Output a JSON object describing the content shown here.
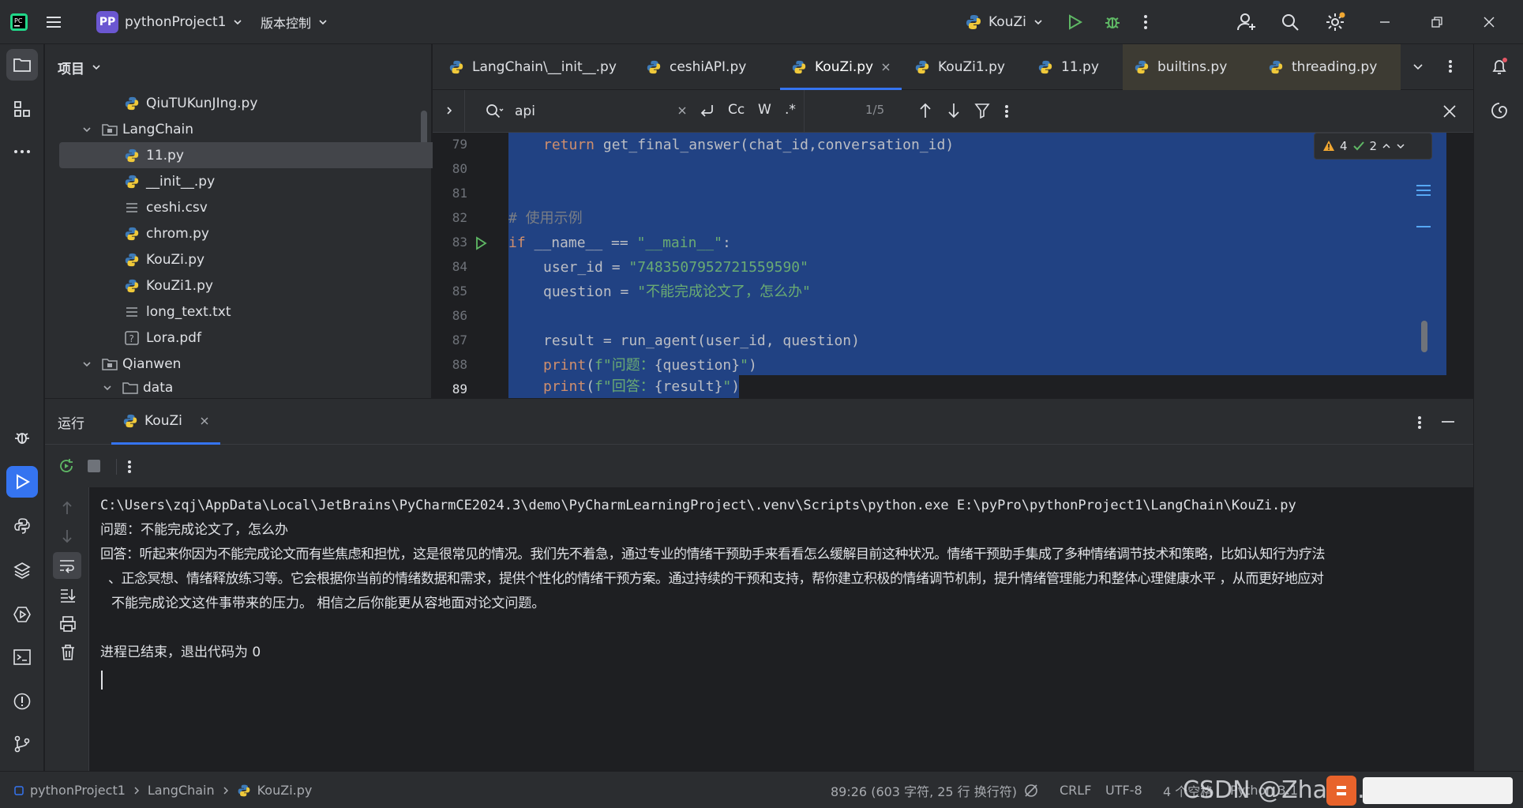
{
  "titlebar": {
    "project_initials": "PP",
    "project_name": "pythonProject1",
    "vcs_label": "版本控制",
    "run_config": "KouZi"
  },
  "project_panel": {
    "title": "项目",
    "items": [
      {
        "label": "QiuTUKunJIng.py",
        "type": "py"
      },
      {
        "label": "LangChain",
        "type": "folder-open"
      },
      {
        "label": "11.py",
        "type": "py",
        "selected": true
      },
      {
        "label": "__init__.py",
        "type": "py"
      },
      {
        "label": "ceshi.csv",
        "type": "text"
      },
      {
        "label": "chrom.py",
        "type": "py"
      },
      {
        "label": "KouZi.py",
        "type": "py"
      },
      {
        "label": "KouZi1.py",
        "type": "py"
      },
      {
        "label": "long_text.txt",
        "type": "text"
      },
      {
        "label": "Lora.pdf",
        "type": "unknown"
      },
      {
        "label": "Qianwen",
        "type": "folder-open"
      },
      {
        "label": "data",
        "type": "folder-open"
      }
    ]
  },
  "editor": {
    "tabs": [
      {
        "label": "LangChain\\__init__.py"
      },
      {
        "label": "ceshiAPI.py"
      },
      {
        "label": "KouZi.py",
        "active": true
      },
      {
        "label": "KouZi1.py"
      },
      {
        "label": "11.py"
      },
      {
        "label": "builtins.py"
      },
      {
        "label": "threading.py"
      }
    ],
    "find": {
      "query": "api",
      "case_label": "Cc",
      "word_label": "W",
      "regex_label": ".*",
      "match_count": "1/5"
    },
    "inspections": {
      "warnings": "4",
      "ok": "2"
    },
    "line_numbers": [
      "79",
      "80",
      "81",
      "82",
      "83",
      "84",
      "85",
      "86",
      "87",
      "88",
      "89"
    ],
    "code": {
      "l79_kw": "return",
      "l79_rest": " get_final_answer(chat_id,conversation_id)",
      "l82": "# 使用示例",
      "l83_kw": "if",
      "l83_mid": " __name__ == ",
      "l83_str": "\"__main__\"",
      "l83_end": ":",
      "l84_a": "user_id = ",
      "l84_str": "\"7483507952721559590\"",
      "l85_a": "question = ",
      "l85_str": "\"不能完成论文了，怎么办\"",
      "l87": "result = run_agent(user_id, question)",
      "l88_fn": "print",
      "l88_a": "(",
      "l88_str1": "f\"问题：",
      "l88_var": "{question}",
      "l88_str2": "\"",
      "l88_b": ")",
      "l89_fn": "print",
      "l89_a": "(",
      "l89_str1": "f\"回答：",
      "l89_var": "{result}",
      "l89_str2": "\"",
      "l89_b": ")"
    }
  },
  "run_panel": {
    "title": "运行",
    "tab_label": "KouZi",
    "console": [
      "C:\\Users\\zqj\\AppData\\Local\\JetBrains\\PyCharmCE2024.3\\demo\\PyCharmLearningProject\\.venv\\Scripts\\python.exe E:\\pyPro\\pythonProject1\\LangChain\\KouZi.py",
      "问题：不能完成论文了，怎么办",
      "回答：听起来你因为不能完成论文而有些焦虑和担忧，这是很常见的情况。我们先不着急，通过专业的情绪干预助手来看看怎么缓解目前这种状况。情绪干预助手集成了多种情绪调节技术和策略，比如认知行为疗法",
      "、正念冥想、情绪释放练习等。它会根据你当前的情绪数据和需求，提供个性化的情绪干预方案。通过持续的干预和支持，帮你建立积极的情绪调节机制，提升情绪管理能力和整体心理健康水平 ，从而更好地应对",
      "不能完成论文这件事带来的压力。 相信之后你能更从容地面对论文问题。",
      "",
      "进程已结束，退出代码为 0"
    ]
  },
  "statusbar": {
    "breadcrumb": [
      "pythonProject1",
      "LangChain",
      "KouZi.py"
    ],
    "position": "89:26 (603 字符, 25 行 换行符)",
    "line_sep": "CRLF",
    "encoding": "UTF-8",
    "indent": "4 个空格",
    "interpreter": "Python 3.1",
    "watermark": "CSDN @Zhang.jQ.."
  },
  "colors": {
    "accent": "#3574f0",
    "selection": "#214283",
    "keyword": "#cf8e6d",
    "string": "#6aab73",
    "run_green": "#5fb865"
  }
}
